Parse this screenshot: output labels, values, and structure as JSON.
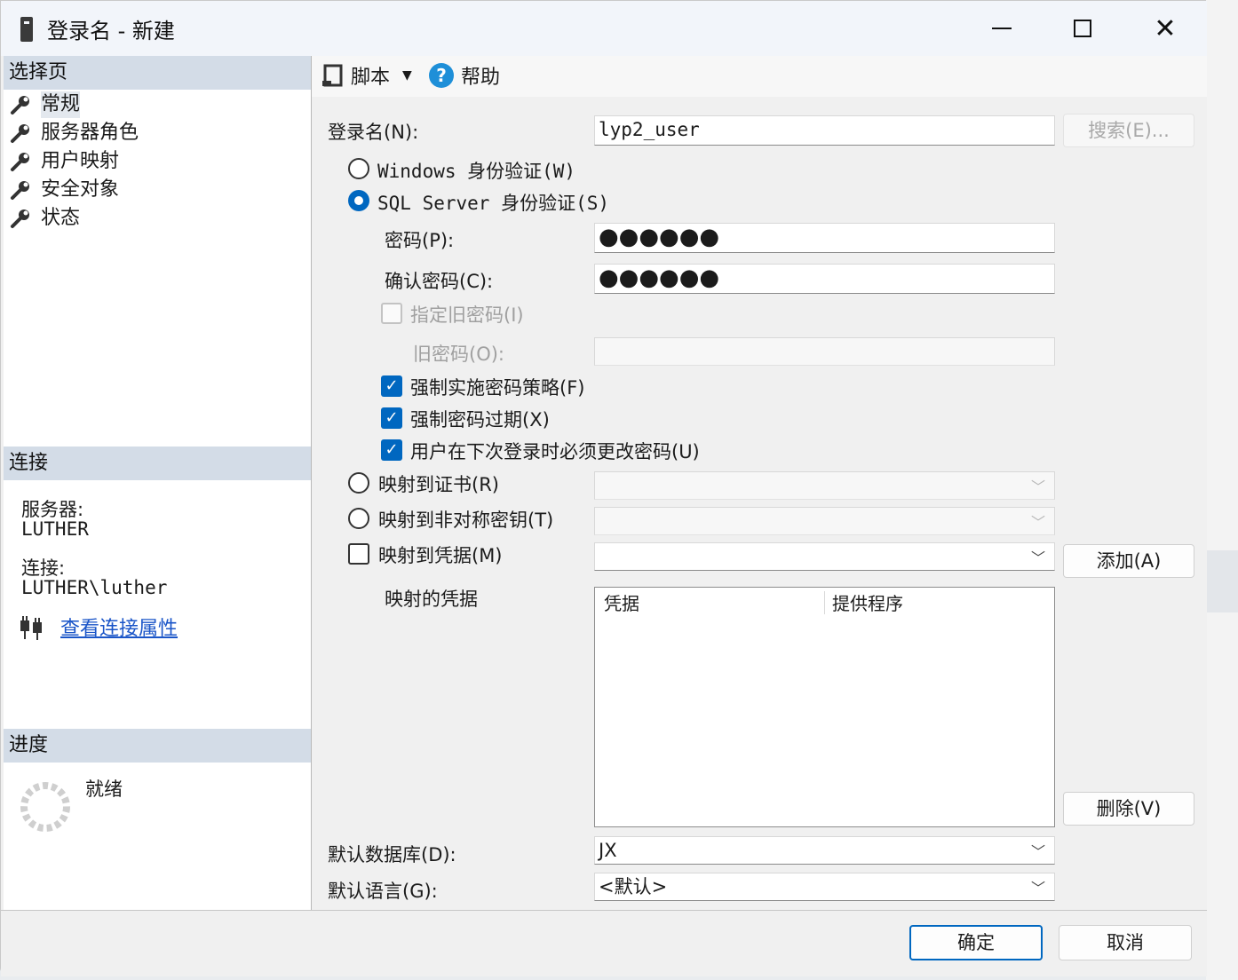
{
  "window": {
    "title": "登录名 - 新建"
  },
  "left": {
    "select_page_header": "选择页",
    "pages": [
      {
        "label": "常规",
        "selected": true
      },
      {
        "label": "服务器角色"
      },
      {
        "label": "用户映射"
      },
      {
        "label": "安全对象"
      },
      {
        "label": "状态"
      }
    ],
    "connection_header": "连接",
    "server_label": "服务器:",
    "server_value": "LUTHER",
    "connection_label": "连接:",
    "connection_value": "LUTHER\\luther",
    "view_props_link": "查看连接属性",
    "progress_header": "进度",
    "progress_status": "就绪"
  },
  "toolbar": {
    "script_label": "脚本",
    "help_label": "帮助"
  },
  "form": {
    "login_name_label": "登录名(N):",
    "login_name_value": "lyp2_user",
    "search_button": "搜索(E)...",
    "windows_auth_label": "Windows 身份验证(W)",
    "sql_auth_label": "SQL Server 身份验证(S)",
    "password_label": "密码(P):",
    "password_value": "●●●●●●",
    "confirm_password_label": "确认密码(C):",
    "confirm_password_value": "●●●●●●",
    "specify_old_password_label": "指定旧密码(I)",
    "old_password_label": "旧密码(O):",
    "old_password_value": "",
    "enforce_policy_label": "强制实施密码策略(F)",
    "enforce_expiration_label": "强制密码过期(X)",
    "must_change_label": "用户在下次登录时必须更改密码(U)",
    "map_certificate_label": "映射到证书(R)",
    "map_asym_key_label": "映射到非对称密钥(T)",
    "map_credential_label": "映射到凭据(M)",
    "add_button": "添加(A)",
    "mapped_credentials_label": "映射的凭据",
    "grid_columns": [
      "凭据",
      "提供程序"
    ],
    "remove_button": "删除(V)",
    "default_db_label": "默认数据库(D):",
    "default_db_value": "JX",
    "default_lang_label": "默认语言(G):",
    "default_lang_value": "<默认>"
  },
  "state": {
    "auth_mode": "sql",
    "specify_old_password": false,
    "enforce_policy": true,
    "enforce_expiration": true,
    "must_change": true,
    "map_certificate": false,
    "map_asym_key": false,
    "map_credential": false
  },
  "footer": {
    "ok_button": "确定",
    "cancel_button": "取消"
  },
  "colors": {
    "accent": "#0067c0",
    "section_header": "#d3dce7",
    "link": "#1a55c8"
  }
}
